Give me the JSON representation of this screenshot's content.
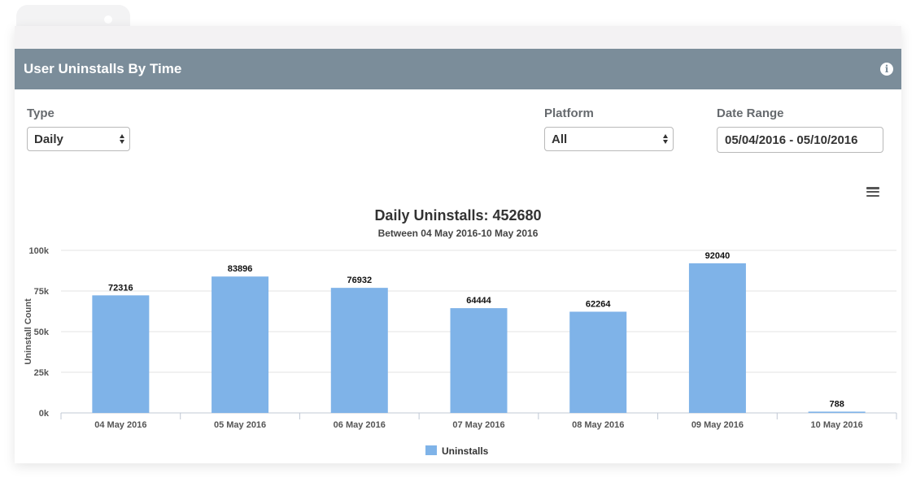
{
  "panel": {
    "title": "User Uninstalls By Time"
  },
  "filters": {
    "type": {
      "label": "Type",
      "value": "Daily"
    },
    "platform": {
      "label": "Platform",
      "value": "All"
    },
    "date_range": {
      "label": "Date Range",
      "value": "05/04/2016 - 05/10/2016"
    }
  },
  "colors": {
    "header": "#7b8d9a",
    "bar": "#7fb3e8"
  },
  "chart_data": {
    "type": "bar",
    "title": "Daily Uninstalls: 452680",
    "subtitle": "Between 04 May 2016-10 May 2016",
    "ylabel": "Uninstall Count",
    "xlabel": "",
    "ylim": [
      0,
      100000
    ],
    "yticks": [
      0,
      25000,
      50000,
      75000,
      100000
    ],
    "ytick_labels": [
      "0k",
      "25k",
      "50k",
      "75k",
      "100k"
    ],
    "grid": true,
    "legend_position": "bottom-center",
    "categories": [
      "04 May 2016",
      "05 May 2016",
      "06 May 2016",
      "07 May 2016",
      "08 May 2016",
      "09 May 2016",
      "10 May 2016"
    ],
    "series": [
      {
        "name": "Uninstalls",
        "values": [
          72316,
          83896,
          76932,
          64444,
          62264,
          92040,
          788
        ]
      }
    ]
  }
}
